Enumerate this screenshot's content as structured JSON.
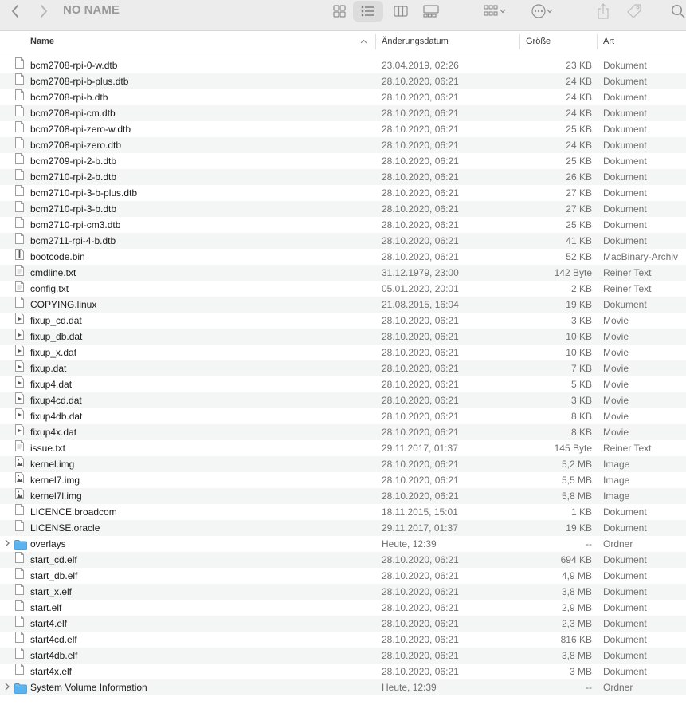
{
  "window": {
    "title": "NO NAME"
  },
  "toolbar": {
    "back_icon": "chevron-left-icon",
    "forward_icon": "chevron-right-icon",
    "views": [
      "icon-view-icon",
      "list-view-icon",
      "column-view-icon",
      "gallery-view-icon"
    ],
    "group_icon": "group-icon",
    "action_icon": "more-icon",
    "share_icon": "share-icon",
    "tag_icon": "tag-icon",
    "search_icon": "search-icon"
  },
  "columns": {
    "name": "Name",
    "date": "Änderungsdatum",
    "size": "Größe",
    "kind": "Art"
  },
  "files": [
    {
      "name": "bcm2708-rpi-0-w.dtb",
      "date": "23.04.2019, 02:26",
      "size": "23 KB",
      "kind": "Dokument",
      "icon": "doc"
    },
    {
      "name": "bcm2708-rpi-b-plus.dtb",
      "date": "28.10.2020, 06:21",
      "size": "24 KB",
      "kind": "Dokument",
      "icon": "doc"
    },
    {
      "name": "bcm2708-rpi-b.dtb",
      "date": "28.10.2020, 06:21",
      "size": "24 KB",
      "kind": "Dokument",
      "icon": "doc"
    },
    {
      "name": "bcm2708-rpi-cm.dtb",
      "date": "28.10.2020, 06:21",
      "size": "24 KB",
      "kind": "Dokument",
      "icon": "doc"
    },
    {
      "name": "bcm2708-rpi-zero-w.dtb",
      "date": "28.10.2020, 06:21",
      "size": "25 KB",
      "kind": "Dokument",
      "icon": "doc"
    },
    {
      "name": "bcm2708-rpi-zero.dtb",
      "date": "28.10.2020, 06:21",
      "size": "24 KB",
      "kind": "Dokument",
      "icon": "doc"
    },
    {
      "name": "bcm2709-rpi-2-b.dtb",
      "date": "28.10.2020, 06:21",
      "size": "25 KB",
      "kind": "Dokument",
      "icon": "doc"
    },
    {
      "name": "bcm2710-rpi-2-b.dtb",
      "date": "28.10.2020, 06:21",
      "size": "26 KB",
      "kind": "Dokument",
      "icon": "doc"
    },
    {
      "name": "bcm2710-rpi-3-b-plus.dtb",
      "date": "28.10.2020, 06:21",
      "size": "27 KB",
      "kind": "Dokument",
      "icon": "doc"
    },
    {
      "name": "bcm2710-rpi-3-b.dtb",
      "date": "28.10.2020, 06:21",
      "size": "27 KB",
      "kind": "Dokument",
      "icon": "doc"
    },
    {
      "name": "bcm2710-rpi-cm3.dtb",
      "date": "28.10.2020, 06:21",
      "size": "25 KB",
      "kind": "Dokument",
      "icon": "doc"
    },
    {
      "name": "bcm2711-rpi-4-b.dtb",
      "date": "28.10.2020, 06:21",
      "size": "41 KB",
      "kind": "Dokument",
      "icon": "doc"
    },
    {
      "name": "bootcode.bin",
      "date": "28.10.2020, 06:21",
      "size": "52 KB",
      "kind": "MacBinary-Archiv",
      "icon": "bin"
    },
    {
      "name": "cmdline.txt",
      "date": "31.12.1979, 23:00",
      "size": "142 Byte",
      "kind": "Reiner Text",
      "icon": "txt"
    },
    {
      "name": "config.txt",
      "date": "05.01.2020, 20:01",
      "size": "2 KB",
      "kind": "Reiner Text",
      "icon": "txt"
    },
    {
      "name": "COPYING.linux",
      "date": "21.08.2015, 16:04",
      "size": "19 KB",
      "kind": "Dokument",
      "icon": "doc"
    },
    {
      "name": "fixup_cd.dat",
      "date": "28.10.2020, 06:21",
      "size": "3 KB",
      "kind": "Movie",
      "icon": "movie"
    },
    {
      "name": "fixup_db.dat",
      "date": "28.10.2020, 06:21",
      "size": "10 KB",
      "kind": "Movie",
      "icon": "movie"
    },
    {
      "name": "fixup_x.dat",
      "date": "28.10.2020, 06:21",
      "size": "10 KB",
      "kind": "Movie",
      "icon": "movie"
    },
    {
      "name": "fixup.dat",
      "date": "28.10.2020, 06:21",
      "size": "7 KB",
      "kind": "Movie",
      "icon": "movie"
    },
    {
      "name": "fixup4.dat",
      "date": "28.10.2020, 06:21",
      "size": "5 KB",
      "kind": "Movie",
      "icon": "movie"
    },
    {
      "name": "fixup4cd.dat",
      "date": "28.10.2020, 06:21",
      "size": "3 KB",
      "kind": "Movie",
      "icon": "movie"
    },
    {
      "name": "fixup4db.dat",
      "date": "28.10.2020, 06:21",
      "size": "8 KB",
      "kind": "Movie",
      "icon": "movie"
    },
    {
      "name": "fixup4x.dat",
      "date": "28.10.2020, 06:21",
      "size": "8 KB",
      "kind": "Movie",
      "icon": "movie"
    },
    {
      "name": "issue.txt",
      "date": "29.11.2017, 01:37",
      "size": "145 Byte",
      "kind": "Reiner Text",
      "icon": "txt"
    },
    {
      "name": "kernel.img",
      "date": "28.10.2020, 06:21",
      "size": "5,2 MB",
      "kind": "Image",
      "icon": "image"
    },
    {
      "name": "kernel7.img",
      "date": "28.10.2020, 06:21",
      "size": "5,5 MB",
      "kind": "Image",
      "icon": "image"
    },
    {
      "name": "kernel7l.img",
      "date": "28.10.2020, 06:21",
      "size": "5,8 MB",
      "kind": "Image",
      "icon": "image"
    },
    {
      "name": "LICENCE.broadcom",
      "date": "18.11.2015, 15:01",
      "size": "1 KB",
      "kind": "Dokument",
      "icon": "doc"
    },
    {
      "name": "LICENSE.oracle",
      "date": "29.11.2017, 01:37",
      "size": "19 KB",
      "kind": "Dokument",
      "icon": "doc"
    },
    {
      "name": "overlays",
      "date": "Heute, 12:39",
      "size": "--",
      "kind": "Ordner",
      "icon": "folder"
    },
    {
      "name": "start_cd.elf",
      "date": "28.10.2020, 06:21",
      "size": "694 KB",
      "kind": "Dokument",
      "icon": "doc"
    },
    {
      "name": "start_db.elf",
      "date": "28.10.2020, 06:21",
      "size": "4,9 MB",
      "kind": "Dokument",
      "icon": "doc"
    },
    {
      "name": "start_x.elf",
      "date": "28.10.2020, 06:21",
      "size": "3,8 MB",
      "kind": "Dokument",
      "icon": "doc"
    },
    {
      "name": "start.elf",
      "date": "28.10.2020, 06:21",
      "size": "2,9 MB",
      "kind": "Dokument",
      "icon": "doc"
    },
    {
      "name": "start4.elf",
      "date": "28.10.2020, 06:21",
      "size": "2,3 MB",
      "kind": "Dokument",
      "icon": "doc"
    },
    {
      "name": "start4cd.elf",
      "date": "28.10.2020, 06:21",
      "size": "816 KB",
      "kind": "Dokument",
      "icon": "doc"
    },
    {
      "name": "start4db.elf",
      "date": "28.10.2020, 06:21",
      "size": "3,8 MB",
      "kind": "Dokument",
      "icon": "doc"
    },
    {
      "name": "start4x.elf",
      "date": "28.10.2020, 06:21",
      "size": "3 MB",
      "kind": "Dokument",
      "icon": "doc"
    },
    {
      "name": "System Volume Information",
      "date": "Heute, 12:39",
      "size": "--",
      "kind": "Ordner",
      "icon": "folder"
    }
  ],
  "colors": {
    "folder": "#5ab3ef",
    "toolbar_bg": "#ececec",
    "alt_row": "#f4f5f5"
  }
}
